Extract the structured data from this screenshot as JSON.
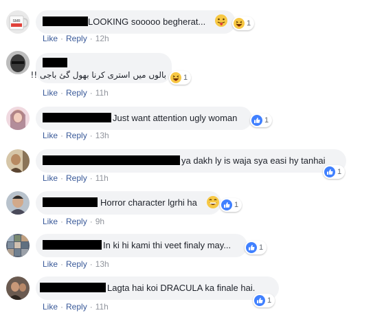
{
  "comments": [
    {
      "text": "LOOKING sooooo begherat...",
      "reaction_emoji": "😛",
      "reaction_icon": "haha-icon",
      "reaction_count": "1",
      "like": "Like",
      "reply": "Reply",
      "time": "12h",
      "avatar_text": "SMR"
    },
    {
      "text": "بالوں میں استری کرنا بھول گئ باجی !!",
      "reaction_icon": "haha-icon",
      "reaction_count": "1",
      "like": "Like",
      "reply": "Reply",
      "time": "11h"
    },
    {
      "text": "Just want attention ugly woman",
      "reaction_icon": "like-icon",
      "reaction_count": "1",
      "like": "Like",
      "reply": "Reply",
      "time": "13h"
    },
    {
      "text": "ya dakh ly is waja sya easi hy tanhai",
      "reaction_icon": "like-icon",
      "reaction_count": "1",
      "like": "Like",
      "reply": "Reply",
      "time": "11h"
    },
    {
      "text": "Horror character lgrhi ha",
      "reaction_icon": "like-icon",
      "reaction_count": "1",
      "like": "Like",
      "reply": "Reply",
      "time": "9h"
    },
    {
      "text": "In ki hi kami thi veet finaly may...",
      "reaction_icon": "like-icon",
      "reaction_count": "1",
      "like": "Like",
      "reply": "Reply",
      "time": "13h"
    },
    {
      "text": "Lagta hai koi DRACULA ka finale hai.",
      "reaction_icon": "like-icon",
      "reaction_count": "1",
      "like": "Like",
      "reply": "Reply",
      "time": "11h"
    }
  ],
  "colors": {
    "link": "#385898",
    "meta": "#90949c",
    "bubble": "#f2f3f5",
    "like_blue": "#4080ff",
    "haha_yellow": "#f7c844"
  }
}
